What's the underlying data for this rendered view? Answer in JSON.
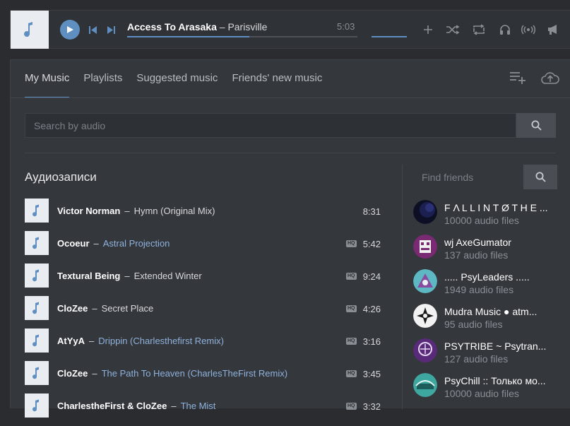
{
  "player": {
    "artist": "Access To Arasaka",
    "separator": "–",
    "title": "Parisville",
    "time": "5:03",
    "progress_fraction": 0.53,
    "icons": [
      "add-icon",
      "shuffle-icon",
      "repeat-icon",
      "headphones-icon",
      "broadcast-icon",
      "megaphone-icon"
    ]
  },
  "tabs": [
    {
      "label": "My Music",
      "active": true
    },
    {
      "label": "Playlists",
      "active": false
    },
    {
      "label": "Suggested music",
      "active": false
    },
    {
      "label": "Friends' new music",
      "active": false
    }
  ],
  "search": {
    "placeholder": "Search by audio"
  },
  "section_title": "Аудиозаписи",
  "tracks": [
    {
      "artist": "Victor Norman",
      "title": "Hymn (Original Mix)",
      "duration": "8:31",
      "hq": false,
      "title_link": false
    },
    {
      "artist": "Ocoeur",
      "title": "Astral Projection",
      "duration": "5:42",
      "hq": true,
      "title_link": true
    },
    {
      "artist": "Textural Being",
      "title": "Extended Winter",
      "duration": "9:24",
      "hq": true,
      "title_link": false
    },
    {
      "artist": "CloZee",
      "title": "Secret Place",
      "duration": "4:26",
      "hq": true,
      "title_link": false
    },
    {
      "artist": "AtYyA",
      "title": "Drippin (Charlesthefirst Remix)",
      "duration": "3:16",
      "hq": true,
      "title_link": true
    },
    {
      "artist": "CloZee",
      "title": "The Path To Heaven (CharlesTheFirst Remix)",
      "duration": "3:45",
      "hq": true,
      "title_link": true
    },
    {
      "artist": "CharlestheFirst & CloZee",
      "title": "The Mist",
      "duration": "3:32",
      "hq": true,
      "title_link": true
    }
  ],
  "hq_label": "HQ",
  "friends_search": {
    "placeholder": "Find friends"
  },
  "friends": [
    {
      "name": "F Λ L L I N T Ø T H E ...",
      "count": "10000 audio files"
    },
    {
      "name": "wj AxeGumator",
      "count": "137 audio files"
    },
    {
      "name": "..... PsyLeaders .....",
      "count": "1949 audio files"
    },
    {
      "name": "Mudra Music ● atm...",
      "count": "95 audio files"
    },
    {
      "name": "PSYTRIBE ~ Psytran...",
      "count": "127 audio files"
    },
    {
      "name": "PsyChill :: Только мо...",
      "count": "10000 audio files"
    }
  ],
  "colors": {
    "accent": "#5f8fc0",
    "link": "#8fb2dc",
    "background": "#34373c"
  }
}
